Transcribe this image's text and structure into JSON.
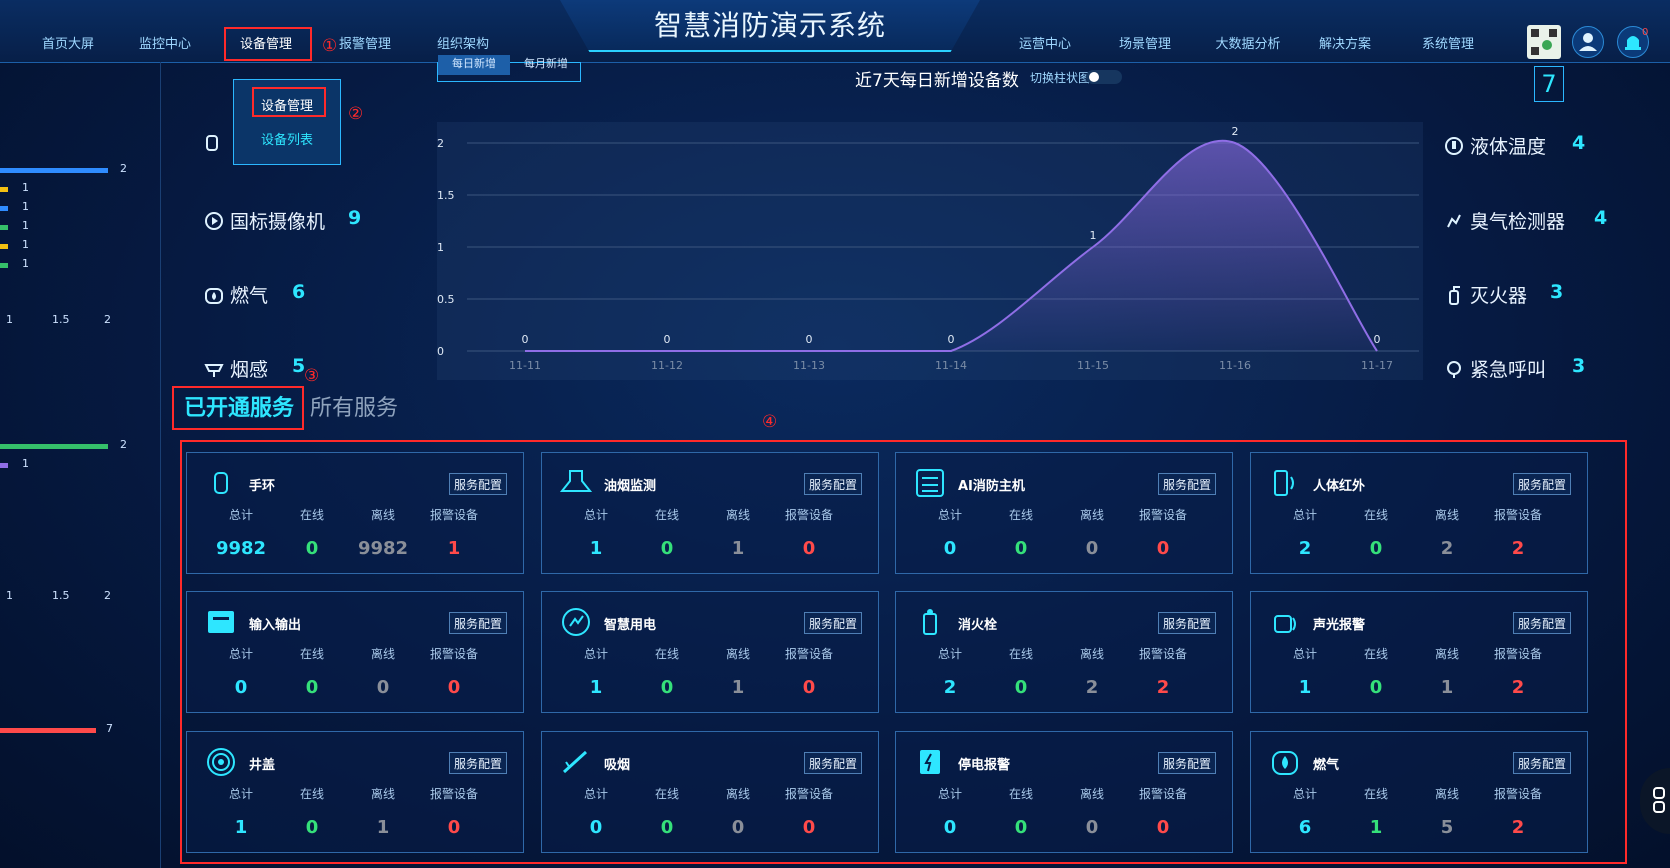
{
  "header": {
    "title": "智慧消防演示系统",
    "nav_left": [
      "首页大屏",
      "监控中心",
      "设备管理",
      "报警管理",
      "组织架构"
    ],
    "nav_right": [
      "运营中心",
      "场景管理",
      "大数据分析",
      "解决方案",
      "系统管理"
    ],
    "notification_count": "0"
  },
  "annotations": {
    "n1": "①",
    "n2": "②",
    "n3": "③",
    "n4": "④"
  },
  "dropdown": {
    "items": [
      "设备管理",
      "设备列表"
    ]
  },
  "top_tabs": [
    "每日新增",
    "每月新增"
  ],
  "left_panel": {
    "top_values": [
      "2",
      "1",
      "1",
      "1",
      "1",
      "1"
    ],
    "top_axis": [
      "1",
      "1.5",
      "2"
    ],
    "mid_values": [
      "2",
      "1"
    ],
    "mid_axis": [
      "1",
      "1.5",
      "2"
    ],
    "bottom_value": "7"
  },
  "devices_left": [
    {
      "label": "国标摄像机",
      "value": "9"
    },
    {
      "label": "燃气",
      "value": "6"
    },
    {
      "label": "烟感",
      "value": "5"
    }
  ],
  "devices_right": [
    {
      "label": "液体温度",
      "value": "4"
    },
    {
      "label": "臭气检测器",
      "value": "4"
    },
    {
      "label": "灭火器",
      "value": "3"
    },
    {
      "label": "紧急呼叫",
      "value": "3"
    }
  ],
  "chart_data": {
    "type": "area",
    "title": "近7天每日新增设备数",
    "switch_label": "切换柱状图",
    "categories": [
      "11-11",
      "11-12",
      "11-13",
      "11-14",
      "11-15",
      "11-16",
      "11-17"
    ],
    "values": [
      0,
      0,
      0,
      0,
      1,
      2,
      0
    ],
    "ylim": [
      0,
      2
    ],
    "yticks": [
      "0",
      "0.5",
      "1",
      "1.5",
      "2"
    ],
    "color": "#8f6ee6"
  },
  "services": {
    "tab_active": "已开通服务",
    "tab_inactive": "所有服务",
    "config_label": "服务配置",
    "col_labels": [
      "总计",
      "在线",
      "离线",
      "报警设备"
    ],
    "cards": [
      {
        "name": "手环",
        "icon": "watch-icon",
        "total": "9982",
        "online": "0",
        "offline": "9982",
        "alarm": "1"
      },
      {
        "name": "油烟监测",
        "icon": "range-hood-icon",
        "total": "1",
        "online": "0",
        "offline": "1",
        "alarm": "0"
      },
      {
        "name": "AI消防主机",
        "icon": "control-panel-icon",
        "total": "0",
        "online": "0",
        "offline": "0",
        "alarm": "0"
      },
      {
        "name": "人体红外",
        "icon": "infrared-sensor-icon",
        "total": "2",
        "online": "0",
        "offline": "2",
        "alarm": "2"
      },
      {
        "name": "输入输出",
        "icon": "io-module-icon",
        "total": "0",
        "online": "0",
        "offline": "0",
        "alarm": "0"
      },
      {
        "name": "智慧用电",
        "icon": "electricity-icon",
        "total": "1",
        "online": "0",
        "offline": "1",
        "alarm": "0"
      },
      {
        "name": "消火栓",
        "icon": "hydrant-icon",
        "total": "2",
        "online": "0",
        "offline": "2",
        "alarm": "2"
      },
      {
        "name": "声光报警",
        "icon": "siren-icon",
        "total": "1",
        "online": "0",
        "offline": "1",
        "alarm": "2"
      },
      {
        "name": "井盖",
        "icon": "manhole-icon",
        "total": "1",
        "online": "0",
        "offline": "1",
        "alarm": "0"
      },
      {
        "name": "吸烟",
        "icon": "smoking-icon",
        "total": "0",
        "online": "0",
        "offline": "0",
        "alarm": "0"
      },
      {
        "name": "停电报警",
        "icon": "power-outage-icon",
        "total": "0",
        "online": "0",
        "offline": "0",
        "alarm": "0"
      },
      {
        "name": "燃气",
        "icon": "gas-icon",
        "total": "6",
        "online": "1",
        "offline": "5",
        "alarm": "2"
      }
    ]
  }
}
